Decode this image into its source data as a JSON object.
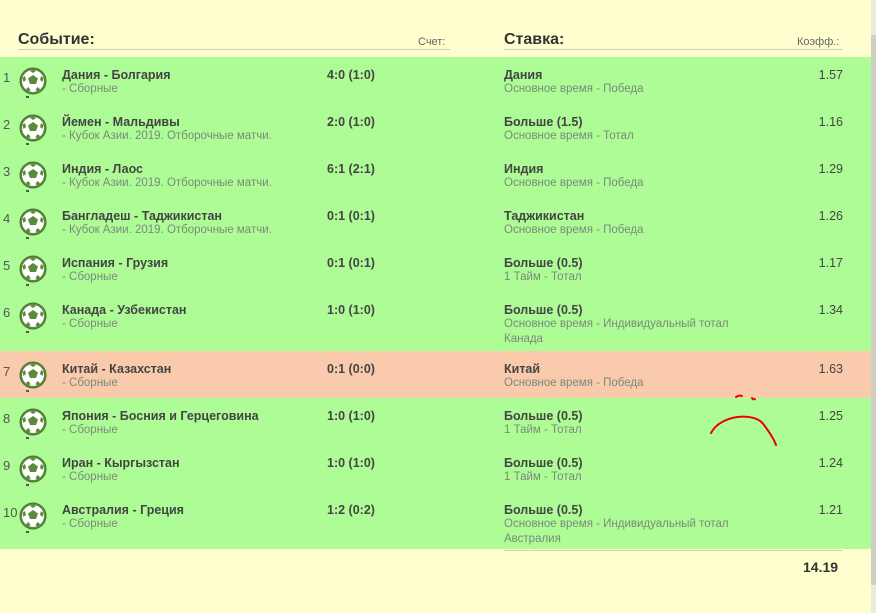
{
  "header": {
    "event_label": "Событие:",
    "score_label": "Счет:",
    "bet_label": "Ставка:",
    "odds_label": "Коэфф.:"
  },
  "colors": {
    "won_row": "#adfc95",
    "lost_row": "#facaac",
    "background": "#fffecf"
  },
  "rows": [
    {
      "num": "1",
      "teams": "Дания - Болгария",
      "league": "- Сборные",
      "score": "4:0 (1:0)",
      "bet": "Дания",
      "bet_detail": "Основное время - Победа",
      "bet_detail2": "",
      "odds": "1.57",
      "status": "won"
    },
    {
      "num": "2",
      "teams": "Йемен - Мальдивы",
      "league": "- Кубок Азии. 2019. Отборочные матчи.",
      "score": "2:0 (1:0)",
      "bet": "Больше (1.5)",
      "bet_detail": "Основное время - Тотал",
      "bet_detail2": "",
      "odds": "1.16",
      "status": "won"
    },
    {
      "num": "3",
      "teams": "Индия - Лаос",
      "league": "- Кубок Азии. 2019. Отборочные матчи.",
      "score": "6:1 (2:1)",
      "bet": "Индия",
      "bet_detail": "Основное время - Победа",
      "bet_detail2": "",
      "odds": "1.29",
      "status": "won"
    },
    {
      "num": "4",
      "teams": "Бангладеш - Таджикистан",
      "league": "- Кубок Азии. 2019. Отборочные матчи.",
      "score": "0:1 (0:1)",
      "bet": "Таджикистан",
      "bet_detail": "Основное время - Победа",
      "bet_detail2": "",
      "odds": "1.26",
      "status": "won"
    },
    {
      "num": "5",
      "teams": "Испания - Грузия",
      "league": "- Сборные",
      "score": "0:1 (0:1)",
      "bet": "Больше (0.5)",
      "bet_detail": "1 Тайм - Тотал",
      "bet_detail2": "",
      "odds": "1.17",
      "status": "won"
    },
    {
      "num": "6",
      "teams": "Канада - Узбекистан",
      "league": "- Сборные",
      "score": "1:0 (1:0)",
      "bet": "Больше (0.5)",
      "bet_detail": "Основное время - Индивидуальный тотал",
      "bet_detail2": "Канада",
      "odds": "1.34",
      "status": "won"
    },
    {
      "num": "7",
      "teams": "Китай - Казахстан",
      "league": "- Сборные",
      "score": "0:1 (0:0)",
      "bet": "Китай",
      "bet_detail": "Основное время - Победа",
      "bet_detail2": "",
      "odds": "1.63",
      "status": "lost"
    },
    {
      "num": "8",
      "teams": "Япония - Босния и Герцеговина",
      "league": "- Сборные",
      "score": "1:0 (1:0)",
      "bet": "Больше (0.5)",
      "bet_detail": "1 Тайм - Тотал",
      "bet_detail2": "",
      "odds": "1.25",
      "status": "won"
    },
    {
      "num": "9",
      "teams": "Иран - Кыргызстан",
      "league": "- Сборные",
      "score": "1:0 (1:0)",
      "bet": "Больше (0.5)",
      "bet_detail": "1 Тайм - Тотал",
      "bet_detail2": "",
      "odds": "1.24",
      "status": "won"
    },
    {
      "num": "10",
      "teams": "Австралия - Греция",
      "league": "- Сборные",
      "score": "1:2 (0:2)",
      "bet": "Больше (0.5)",
      "bet_detail": "Основное время - Индивидуальный тотал",
      "bet_detail2": "Австралия",
      "odds": "1.21",
      "status": "won"
    }
  ],
  "total_odds": "14.19"
}
